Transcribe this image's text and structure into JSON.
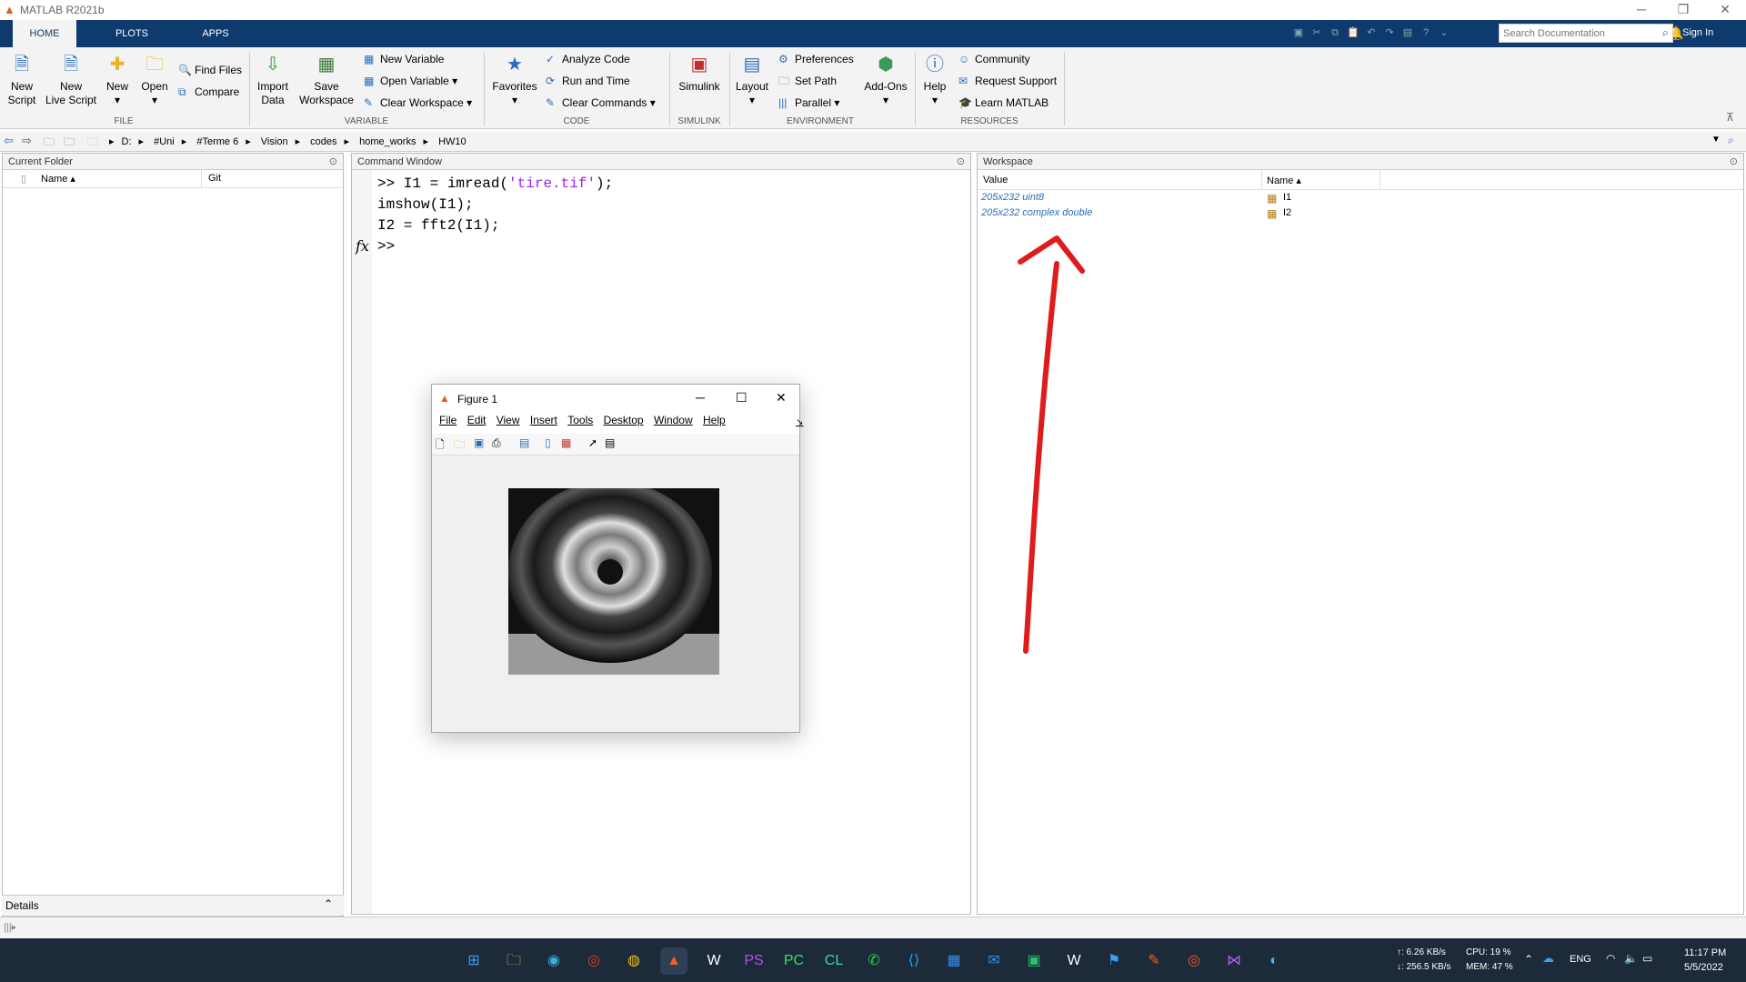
{
  "window": {
    "title": "MATLAB R2021b"
  },
  "tabs": [
    "HOME",
    "PLOTS",
    "APPS"
  ],
  "search": {
    "placeholder": "Search Documentation"
  },
  "signin": "Sign In",
  "ribbon": {
    "file": {
      "new_script": [
        "New",
        "Script"
      ],
      "new_live_script": [
        "New",
        "Live Script"
      ],
      "new": "New",
      "open": "Open",
      "find_files": "Find Files",
      "compare": "Compare",
      "group": "FILE"
    },
    "variable": {
      "import_data": [
        "Import",
        "Data"
      ],
      "save_workspace": [
        "Save",
        "Workspace"
      ],
      "new_variable": "New Variable",
      "open_variable": "Open Variable ▾",
      "clear_workspace": "Clear Workspace ▾",
      "group": "VARIABLE"
    },
    "code": {
      "favorites": "Favorites",
      "analyze_code": "Analyze Code",
      "run_and_time": "Run and Time",
      "clear_commands": "Clear Commands ▾",
      "group": "CODE"
    },
    "simulink": {
      "label": "Simulink",
      "group": "SIMULINK"
    },
    "environment": {
      "layout": "Layout",
      "preferences": "Preferences",
      "set_path": "Set Path",
      "parallel": "Parallel ▾",
      "add_ons": "Add-Ons",
      "group": "ENVIRONMENT"
    },
    "resources": {
      "help": "Help",
      "community": "Community",
      "request_support": "Request Support",
      "learn_matlab": "Learn MATLAB",
      "group": "RESOURCES"
    }
  },
  "address": {
    "path": [
      "D:",
      "#Uni",
      "#Terme 6",
      "Vision",
      "codes",
      "home_works",
      "HW10"
    ]
  },
  "current_folder": {
    "title": "Current Folder",
    "col_name": "Name ▴",
    "col_git": "Git",
    "details": "Details"
  },
  "command_window": {
    "title": "Command Window",
    "lines": [
      ">> I1 = imread(",
      "'tire.tif'",
      ");",
      "imshow(I1);",
      "I2 = fft2(I1);"
    ],
    "prompt": ">>",
    "fx": "fx"
  },
  "workspace": {
    "title": "Workspace",
    "col_value": "Value",
    "col_name": "Name ▴",
    "rows": [
      {
        "value": "205x232 uint8",
        "name": "I1"
      },
      {
        "value": "205x232 complex double",
        "name": "I2"
      }
    ]
  },
  "figure": {
    "title": "Figure 1",
    "menu": [
      "File",
      "Edit",
      "View",
      "Insert",
      "Tools",
      "Desktop",
      "Window",
      "Help"
    ]
  },
  "taskbar": {
    "net_up": "↑: 6.26 KB/s",
    "net_down": "↓: 256.5 KB/s",
    "cpu": "CPU: 19 %",
    "mem": "MEM: 47 %",
    "lang": "ENG",
    "time": "11:17 PM",
    "date": "5/5/2022"
  },
  "colors": {
    "accent": "#0e3a6e",
    "link": "#2a6ebb",
    "annotation": "#e01b1b"
  }
}
